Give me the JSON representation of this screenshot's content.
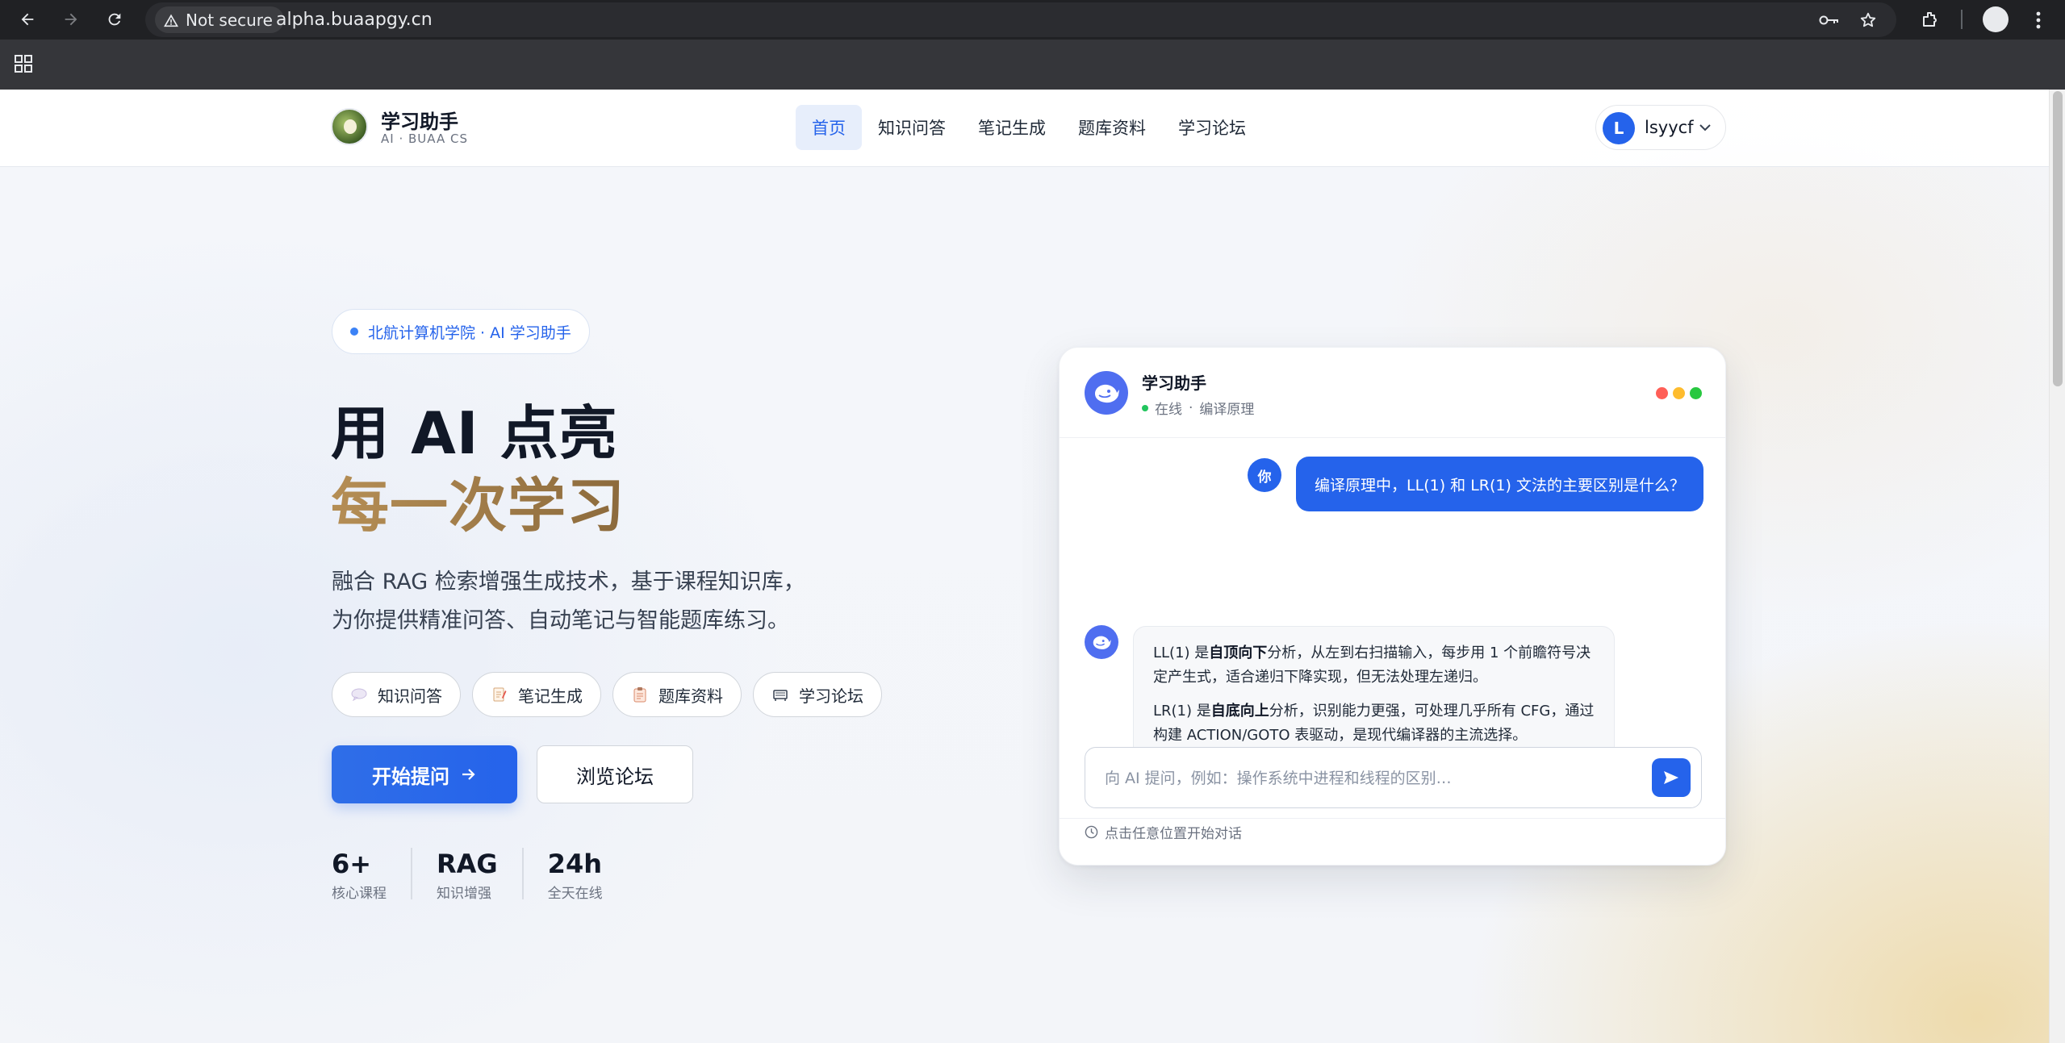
{
  "browser": {
    "security_label": "Not secure",
    "url": "alpha.buaapgy.cn"
  },
  "header": {
    "brand_title": "学习助手",
    "brand_sub": "AI · BUAA CS",
    "nav": [
      {
        "label": "首页",
        "active": true
      },
      {
        "label": "知识问答",
        "active": false
      },
      {
        "label": "笔记生成",
        "active": false
      },
      {
        "label": "题库资料",
        "active": false
      },
      {
        "label": "学习论坛",
        "active": false
      }
    ],
    "user": {
      "initial": "L",
      "name": "lsyycf"
    }
  },
  "hero": {
    "badge": "北航计算机学院 · AI 学习助手",
    "title_line1": "用 AI 点亮",
    "title_line2": "每一次学习",
    "desc_line1": "融合 RAG 检索增强生成技术，基于课程知识库，",
    "desc_line2": "为你提供精准问答、自动笔记与智能题库练习。",
    "chips": [
      {
        "icon": "speech-bubble-icon",
        "label": "知识问答"
      },
      {
        "icon": "memo-icon",
        "label": "笔记生成"
      },
      {
        "icon": "clipboard-icon",
        "label": "题库资料"
      },
      {
        "icon": "forum-icon",
        "label": "学习论坛"
      }
    ],
    "primary_button": "开始提问",
    "secondary_button": "浏览论坛",
    "stats": [
      {
        "value": "6+",
        "label": "核心课程"
      },
      {
        "value": "RAG",
        "label": "知识增强"
      },
      {
        "value": "24h",
        "label": "全天在线"
      }
    ]
  },
  "chat": {
    "title": "学习助手",
    "status": "在线",
    "topic": "编译原理",
    "user_avatar": "你",
    "user_message": "编译原理中，LL(1) 和 LR(1) 文法的主要区别是什么？",
    "bot_p1_prefix": "LL(1) 是",
    "bot_p1_bold": "自顶向下",
    "bot_p1_rest": "分析，从左到右扫描输入，每步用 1 个前瞻符号决定产生式，适合递归下降实现，但无法处理左递归。",
    "bot_p2_prefix": "LR(1) 是",
    "bot_p2_bold": "自底向上",
    "bot_p2_rest": "分析，识别能力更强，可处理几乎所有 CFG，通过构建 ACTION/GOTO 表驱动，是现代编译器的主流选择。",
    "input_placeholder": "向 AI 提问，例如：操作系统中进程和线程的区别…",
    "hint": "点击任意位置开始对话"
  },
  "colors": {
    "accent": "#2563eb",
    "gold": "#a07c4a",
    "dot_red": "#ff5f57",
    "dot_yellow": "#febc2e",
    "dot_green": "#28c840"
  }
}
